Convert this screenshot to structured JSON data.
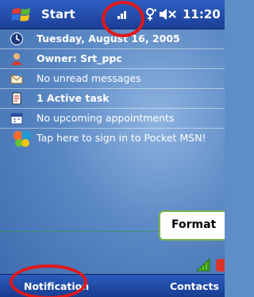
{
  "title_bar": {
    "start_label": "Start",
    "time": "11:20"
  },
  "today": {
    "date": "Tuesday, August 16, 2005",
    "owner": "Owner: Srt_ppc",
    "messages": "No unread messages",
    "tasks": "1 Active task",
    "appointments": "No upcoming appointments",
    "msn": "Tap here to sign in to Pocket MSN!"
  },
  "callout": {
    "label": "Format"
  },
  "bottom_bar": {
    "left_softkey": "Notification",
    "right_softkey": "Contacts"
  },
  "icons": [
    "windows-flag-icon",
    "signal-icon",
    "connectivity-icon",
    "speaker-muted-icon",
    "calendar-icon",
    "owner-icon",
    "messages-icon",
    "tasks-icon",
    "appointments-icon",
    "msn-butterfly-icon",
    "signal-strength-icon"
  ],
  "colors": {
    "title_bar": "#1f46a6",
    "annotation": "#e11818",
    "callout_border": "#7ab648"
  }
}
